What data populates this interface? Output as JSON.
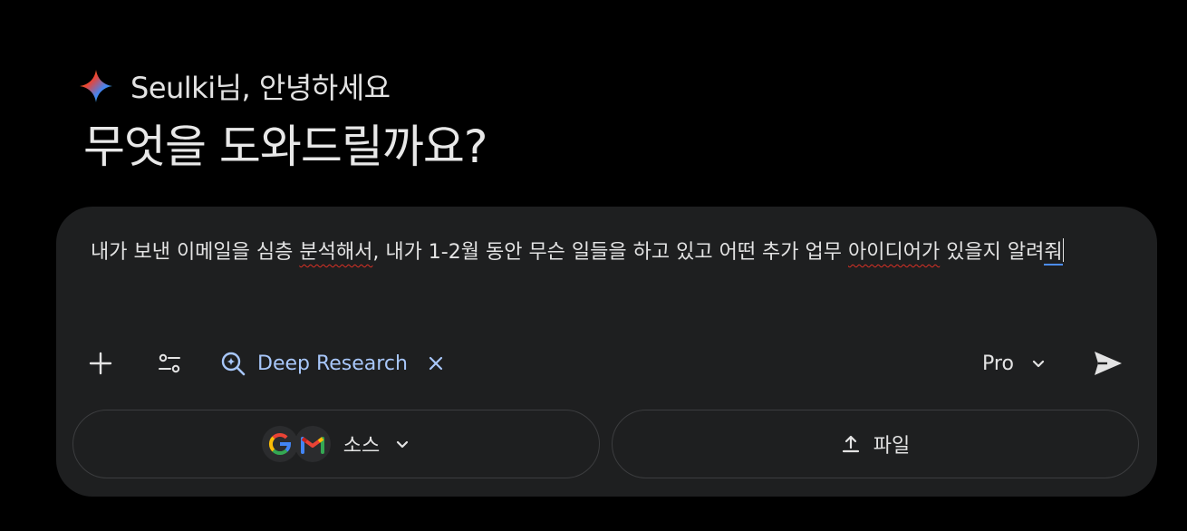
{
  "greeting": {
    "text": "Seulki님, 안녕하세요",
    "headline": "무엇을 도와드릴까요?",
    "icon": "gemini-sparkle-icon"
  },
  "prompt": {
    "part1": "내가 보낸 이메일을 심층 ",
    "misspelled1": "분석해서",
    "part2": ", 내가 1-2월 동안 무슨 일들을 하고 있고 어떤 추가 업무 ",
    "misspelled2": "아이디어가",
    "part3": " 있을지 알려",
    "caret_word": "줘"
  },
  "toolbar": {
    "add_icon": "plus-icon",
    "tools_icon": "tune-icon",
    "deep_research_label": "Deep Research",
    "deep_research_icon": "deep-research-icon",
    "close_icon": "close-icon",
    "model_label": "Pro",
    "send_icon": "send-icon"
  },
  "sources": {
    "label": "소스",
    "icons": [
      "google-icon",
      "gmail-icon"
    ]
  },
  "file": {
    "label": "파일",
    "icon": "upload-icon"
  },
  "colors": {
    "background": "#000000",
    "composer": "#1e1f20",
    "accent": "#a8c7fa",
    "text": "#e3e3e3",
    "spell_error": "#d93025",
    "border": "#3c3d3f"
  }
}
